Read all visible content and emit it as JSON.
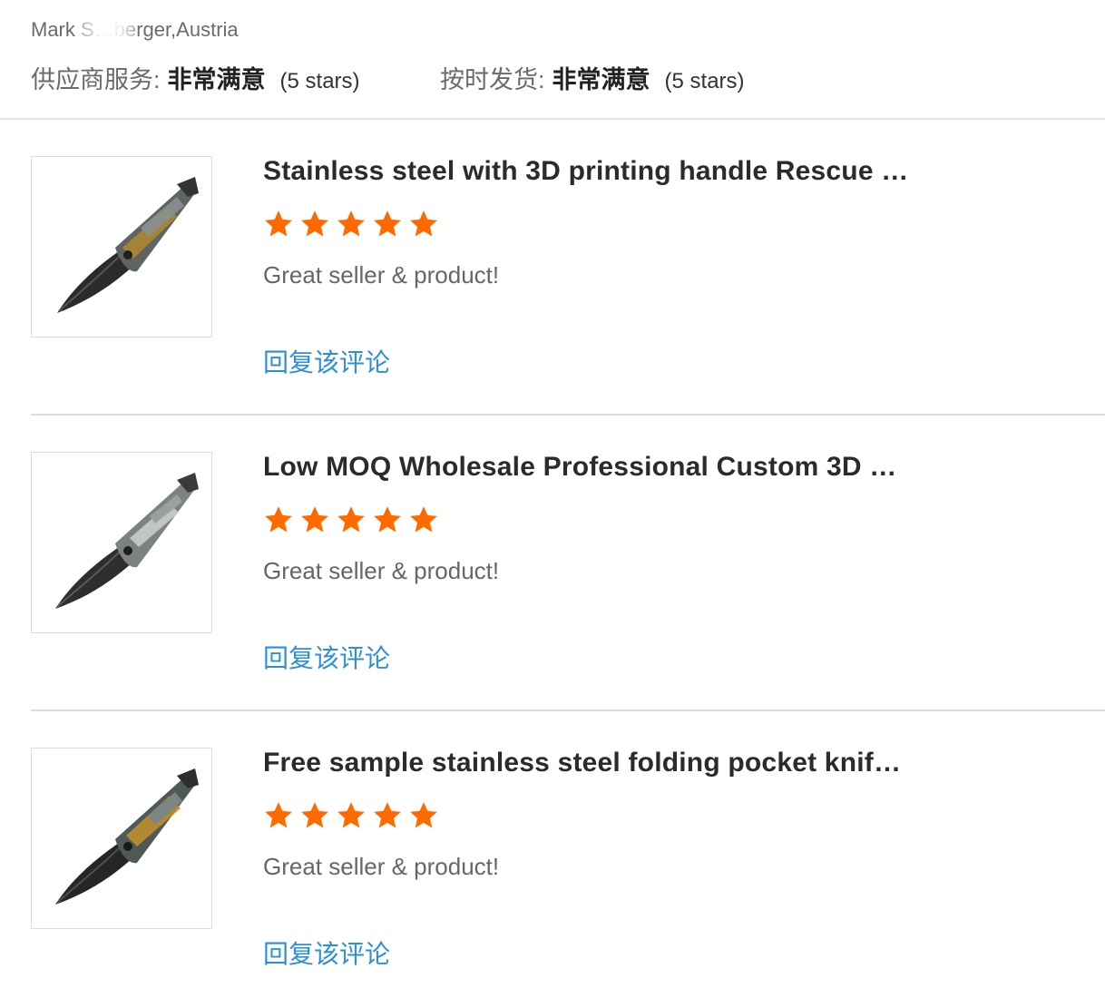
{
  "reviewer": {
    "name": "Mark S…berger,Austria"
  },
  "ratings": [
    {
      "label": "供应商服务:",
      "value": "非常满意",
      "stars_text": "(5 stars)"
    },
    {
      "label": "按时发货:",
      "value": "非常满意",
      "stars_text": "(5 stars)"
    }
  ],
  "items": [
    {
      "title": "Stainless steel with 3D printing handle Rescue …",
      "rating": 5,
      "comment": "Great seller & product!",
      "reply_label": "回复该评论",
      "image_icon": "folding-knife-icon"
    },
    {
      "title": "Low MOQ Wholesale Professional Custom 3D …",
      "rating": 5,
      "comment": "Great seller & product!",
      "reply_label": "回复该评论",
      "image_icon": "folding-knife-icon"
    },
    {
      "title": "Free sample stainless steel folding pocket knif…",
      "rating": 5,
      "comment": "Great seller & product!",
      "reply_label": "回复该评论",
      "image_icon": "folding-knife-icon"
    }
  ],
  "colors": {
    "star": "#ff6a00",
    "link": "#2b8fd9"
  }
}
